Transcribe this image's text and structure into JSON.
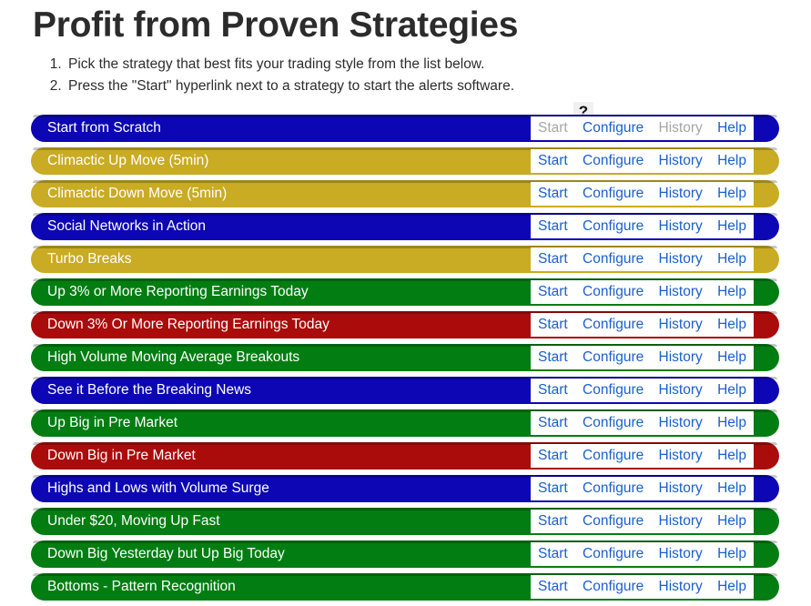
{
  "header": {
    "title": "Profit from Proven Strategies",
    "help_icon": "?",
    "instructions": [
      "Pick the strategy that best fits your trading style from the list below.",
      "Press the \"Start\" hyperlink next to a strategy to start the alerts software."
    ]
  },
  "links": {
    "start": "Start",
    "configure": "Configure",
    "history": "History",
    "help": "Help"
  },
  "colors": {
    "blue": "#0d06b4",
    "gold": "#c9ab24",
    "green": "#027d12",
    "red": "#aa0c0c",
    "link": "#1a5fd0",
    "link_disabled": "#a6a6a6",
    "row_text": "#ffffff",
    "title": "#2b2b2b"
  },
  "strategies": [
    {
      "name": "Start from Scratch",
      "color": "blue",
      "start_enabled": false,
      "history_enabled": false
    },
    {
      "name": "Climactic Up Move (5min)",
      "color": "gold",
      "start_enabled": true,
      "history_enabled": true
    },
    {
      "name": "Climactic Down Move (5min)",
      "color": "gold",
      "start_enabled": true,
      "history_enabled": true
    },
    {
      "name": "Social Networks in Action",
      "color": "blue",
      "start_enabled": true,
      "history_enabled": true
    },
    {
      "name": "Turbo Breaks",
      "color": "gold",
      "start_enabled": true,
      "history_enabled": true
    },
    {
      "name": "Up 3% or More Reporting Earnings Today",
      "color": "green",
      "start_enabled": true,
      "history_enabled": true
    },
    {
      "name": "Down 3% Or More Reporting Earnings Today",
      "color": "red",
      "start_enabled": true,
      "history_enabled": true
    },
    {
      "name": "High Volume Moving Average Breakouts",
      "color": "green",
      "start_enabled": true,
      "history_enabled": true
    },
    {
      "name": "See it Before the Breaking News",
      "color": "blue",
      "start_enabled": true,
      "history_enabled": true
    },
    {
      "name": "Up Big in Pre Market",
      "color": "green",
      "start_enabled": true,
      "history_enabled": true
    },
    {
      "name": "Down Big in Pre Market",
      "color": "red",
      "start_enabled": true,
      "history_enabled": true
    },
    {
      "name": "Highs and Lows with Volume Surge",
      "color": "blue",
      "start_enabled": true,
      "history_enabled": true
    },
    {
      "name": "Under $20, Moving Up Fast",
      "color": "green",
      "start_enabled": true,
      "history_enabled": true
    },
    {
      "name": "Down Big Yesterday but Up Big Today",
      "color": "green",
      "start_enabled": true,
      "history_enabled": true
    },
    {
      "name": "Bottoms - Pattern Recognition",
      "color": "green",
      "start_enabled": true,
      "history_enabled": true
    }
  ]
}
